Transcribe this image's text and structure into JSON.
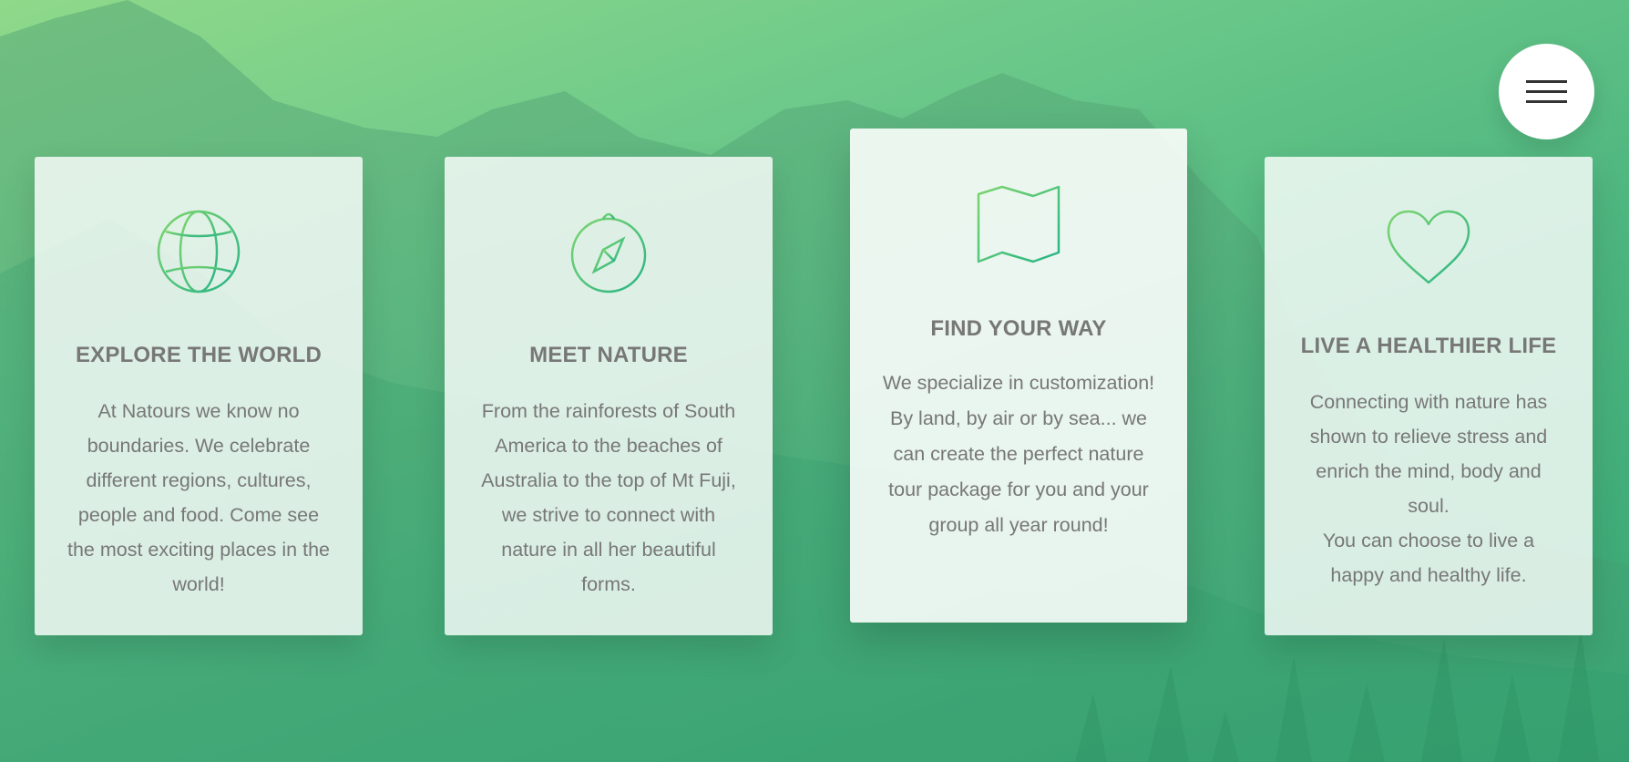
{
  "menu": {
    "icon": "hamburger-icon"
  },
  "features": [
    {
      "icon": "globe-icon",
      "title": "EXPLORE THE WORLD",
      "text": "At Natours we know no boundaries. We celebrate different regions, cultures, people and food. Come see the most exciting places in the world!"
    },
    {
      "icon": "compass-icon",
      "title": "MEET NATURE",
      "text": "From the rainforests of South America to the beaches of Australia to the top of Mt Fuji, we strive to connect with nature in all her beautiful forms."
    },
    {
      "icon": "map-icon",
      "title": "FIND YOUR WAY",
      "text_lines": [
        "We specialize in customization!",
        "By land, by air or by sea... we can create the perfect nature tour package for you and your group all year round!"
      ]
    },
    {
      "icon": "heart-icon",
      "title": "LIVE A HEALTHIER LIFE",
      "text_lines": [
        "Connecting with nature has shown to relieve stress and enrich the mind, body and soul.",
        "You can choose to live a happy and healthy life."
      ]
    }
  ],
  "colors": {
    "accent_light": "#7ed56f",
    "accent_dark": "#28b485",
    "text": "#777777"
  }
}
